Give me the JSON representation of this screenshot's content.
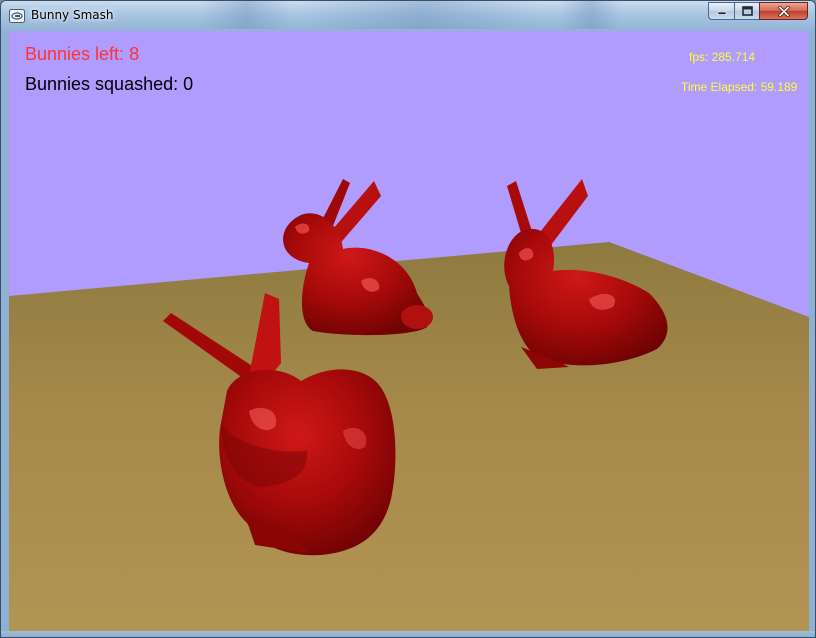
{
  "window": {
    "title": "Bunny Smash",
    "app_icon": "window-app-icon",
    "buttons": [
      "minimize-icon",
      "maximize-icon",
      "close-icon"
    ]
  },
  "hud": {
    "bunnies_left": "Bunnies left: 8",
    "bunnies_squashed": "Bunnies squashed: 0",
    "fps": "fps: 285.714",
    "time_elapsed": "Time Elapsed: 59.189"
  },
  "colors": {
    "sky": "#b09bff",
    "floor": "#a88a4a",
    "bunny": "#a80a0a",
    "bunnies_left_text": "#ff3333",
    "bunnies_squashed_text": "#000000",
    "fps_text": "#ffff33",
    "time_text": "#ffff33",
    "titlebar": "#a8c4e1",
    "close_button": "#c0402a"
  },
  "scene": {
    "bunnies_visible": 3
  }
}
